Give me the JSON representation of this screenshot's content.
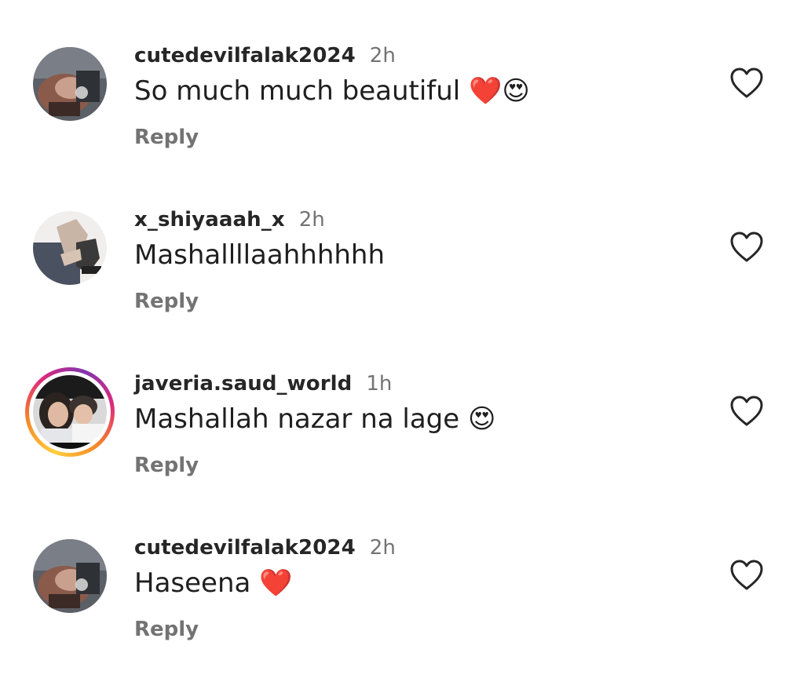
{
  "comments": [
    {
      "username": "cutedevilfalak2024",
      "time": "2h",
      "text": "So much much beautiful ❤️😍",
      "reply_label": "Reply",
      "avatar_icon": "profile-photo",
      "liked": false
    },
    {
      "username": "x_shiyaaah_x",
      "time": "2h",
      "text": "Mashallllaahhhhhh",
      "reply_label": "Reply",
      "avatar_icon": "profile-photo",
      "liked": false
    },
    {
      "username": "javeria.saud_world",
      "time": "1h",
      "text": "Mashallah nazar na lage 😍",
      "reply_label": "Reply",
      "avatar_icon": "profile-photo-story-ring",
      "liked": false
    },
    {
      "username": "cutedevilfalak2024",
      "time": "2h",
      "text": "Haseena ❤️",
      "reply_label": "Reply",
      "avatar_icon": "profile-photo",
      "liked": false
    }
  ],
  "colors": {
    "username": "#262626",
    "time": "#737373",
    "reply": "#737373",
    "text": "#1f1f1f",
    "heart_outline": "#262626",
    "story_ring": [
      "#ffcf3a",
      "#f58529",
      "#dd2a7b",
      "#8134af"
    ]
  },
  "icons": {
    "like": "heart-outline-icon"
  }
}
